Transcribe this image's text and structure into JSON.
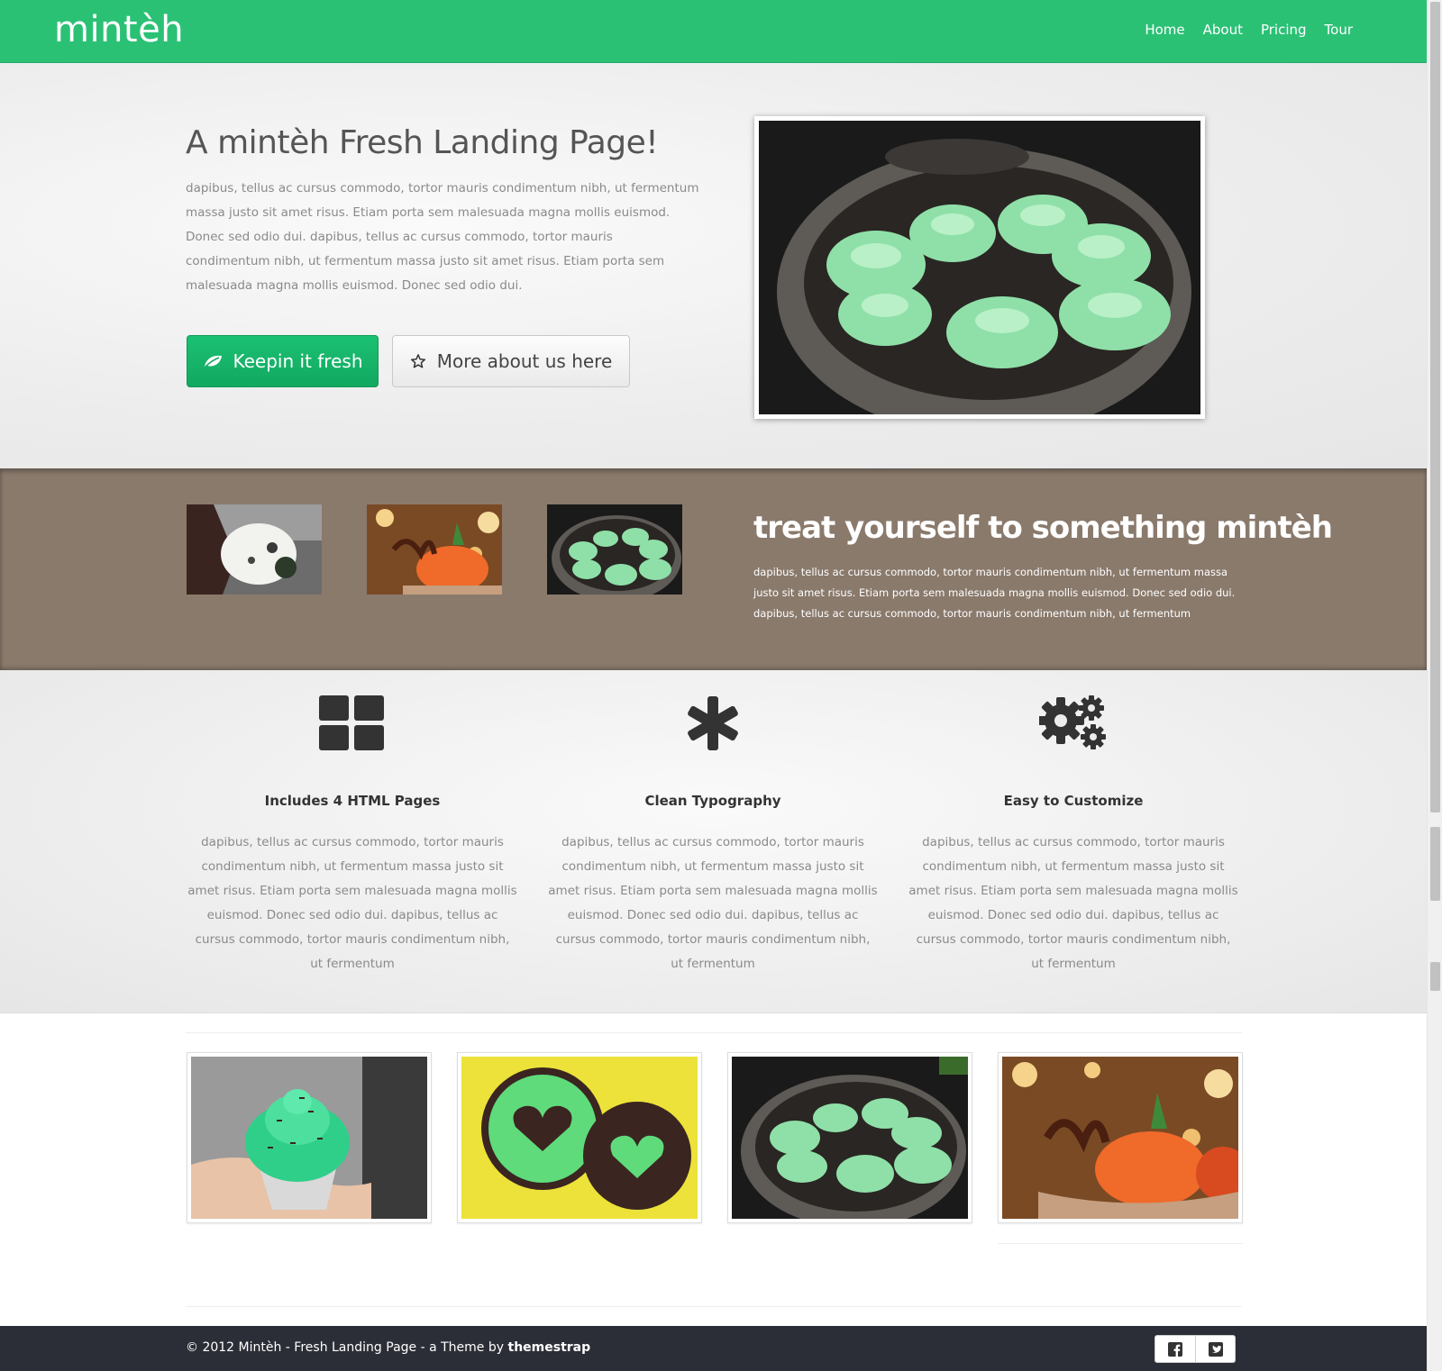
{
  "navbar": {
    "brand": "mintèh",
    "links": [
      "Home",
      "About",
      "Pricing",
      "Tour"
    ]
  },
  "hero": {
    "title": "A mintèh Fresh Landing Page!",
    "text": "dapibus, tellus ac cursus commodo, tortor mauris condimentum nibh, ut fermentum massa justo sit amet risus. Etiam porta sem malesuada magna mollis euismod. Donec sed odio dui. dapibus, tellus ac cursus commodo, tortor mauris condimentum nibh, ut fermentum massa justo sit amet risus. Etiam porta sem malesuada magna mollis euismod. Donec sed odio dui.",
    "primary_button": "Keepin it fresh",
    "secondary_button": "More about us here",
    "primary_icon": "leaf-icon",
    "secondary_icon": "star-icon"
  },
  "band": {
    "title": "treat yourself to something mintèh",
    "text": "dapibus, tellus ac cursus commodo, tortor mauris condimentum nibh, ut fermentum massa justo sit amet risus. Etiam porta sem malesuada magna mollis euismod. Donec sed odio dui. dapibus, tellus ac cursus commodo, tortor mauris condimentum nibh, ut fermentum"
  },
  "features": [
    {
      "icon": "grid-icon",
      "title": "Includes 4 HTML Pages",
      "text": "dapibus, tellus ac cursus commodo, tortor mauris condimentum nibh, ut fermentum massa justo sit amet risus. Etiam porta sem malesuada magna mollis euismod. Donec sed odio dui. dapibus, tellus ac cursus commodo, tortor mauris condimentum nibh, ut fermentum"
    },
    {
      "icon": "asterisk-icon",
      "title": "Clean Typography",
      "text": "dapibus, tellus ac cursus commodo, tortor mauris condimentum nibh, ut fermentum massa justo sit amet risus. Etiam porta sem malesuada magna mollis euismod. Donec sed odio dui. dapibus, tellus ac cursus commodo, tortor mauris condimentum nibh, ut fermentum"
    },
    {
      "icon": "gears-icon",
      "title": "Easy to Customize",
      "text": "dapibus, tellus ac cursus commodo, tortor mauris condimentum nibh, ut fermentum massa justo sit amet risus. Etiam porta sem malesuada magna mollis euismod. Donec sed odio dui. dapibus, tellus ac cursus commodo, tortor mauris condimentum nibh, ut fermentum"
    }
  ],
  "footer": {
    "text": "© 2012 Mintèh - Fresh Landing Page - a Theme by ",
    "author": "themestrap",
    "social_icons": [
      "facebook-icon",
      "twitter-icon"
    ]
  },
  "colors": {
    "brand_green": "#2bc175",
    "button_green": "#11a860",
    "band_brown": "#8a7a6c",
    "footer_dark": "#2c2e37"
  }
}
